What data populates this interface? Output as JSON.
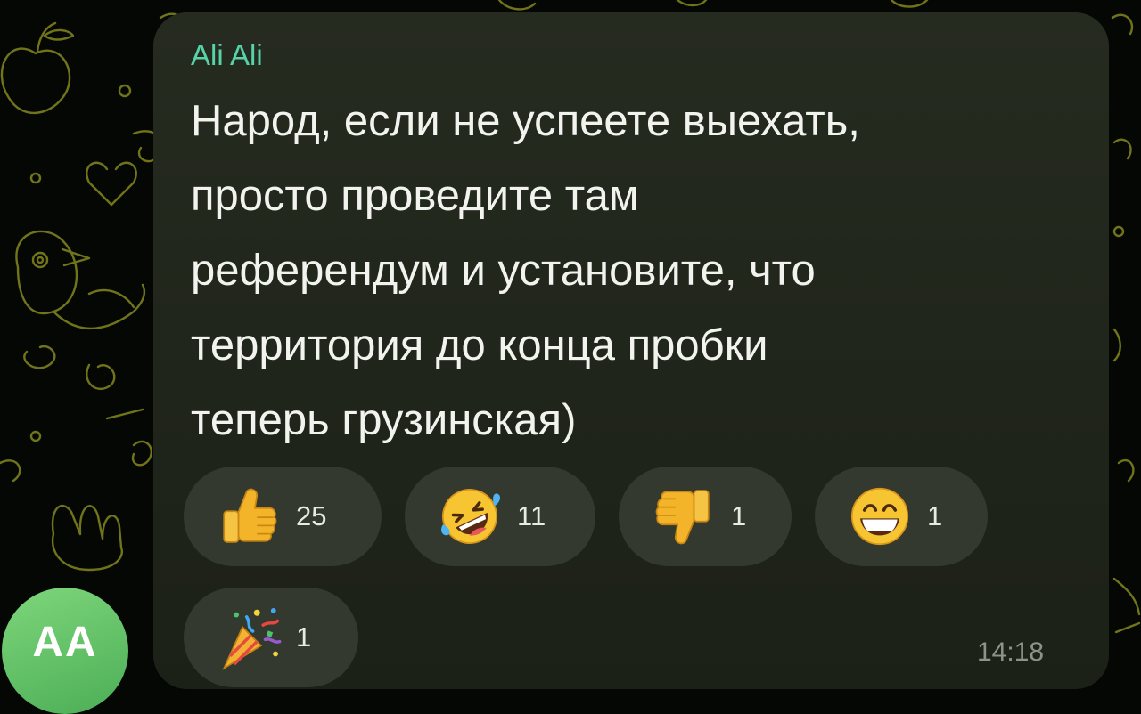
{
  "chat": {
    "sender_name": "Ali Ali",
    "message_lines": [
      "Народ, если не успеете выехать,",
      "просто проведите там",
      "референдум и установите, что",
      "территория до конца пробки",
      "теперь грузинская)"
    ],
    "time": "14:18",
    "sender_avatar_initials": "AA"
  },
  "reactions": [
    {
      "icon": "thumbs-up-icon",
      "count": "25"
    },
    {
      "icon": "rofl-face-icon",
      "count": "11"
    },
    {
      "icon": "thumbs-down-icon",
      "count": "1"
    },
    {
      "icon": "grinning-face-icon",
      "count": "1"
    },
    {
      "icon": "party-popper-icon",
      "count": "1"
    }
  ],
  "colors": {
    "background": "#050705",
    "bubble": "#232820",
    "sender_name": "#56d3a8",
    "message_text": "#f2f3ef",
    "reaction_pill": "#33392e",
    "avatar": "#5fbf63",
    "doodle_pattern": "#8a8c1f"
  }
}
